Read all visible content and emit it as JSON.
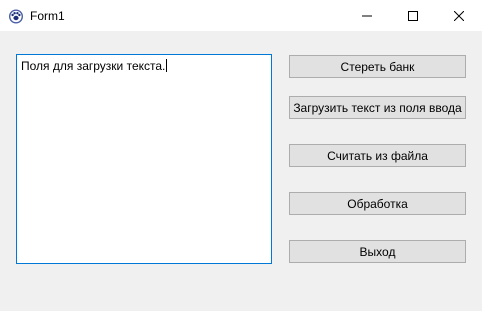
{
  "window": {
    "title": "Form1"
  },
  "textbox": {
    "value": "Поля для загрузки текста."
  },
  "buttons": {
    "clear_bank": "Стереть банк",
    "load_from_input": "Загрузить текст из поля ввода",
    "read_from_file": "Считать из файла",
    "process": "Обработка",
    "exit": "Выход"
  },
  "colors": {
    "focus_border": "#0078d7",
    "button_face": "#e1e1e1",
    "form_bg": "#f0f0f0"
  }
}
